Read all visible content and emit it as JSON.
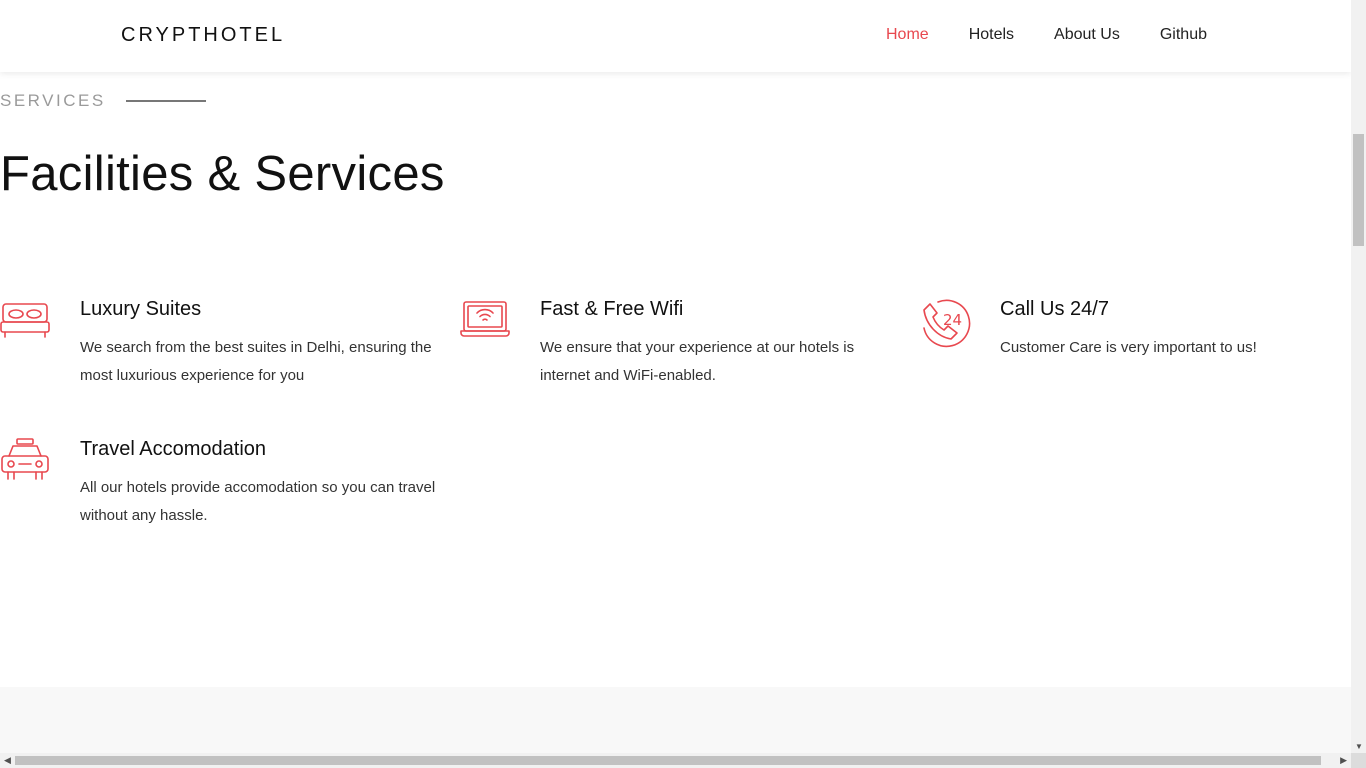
{
  "header": {
    "brand": "CRYPTHOTEL",
    "nav": [
      {
        "label": "Home",
        "active": true
      },
      {
        "label": "Hotels",
        "active": false
      },
      {
        "label": "About Us",
        "active": false
      },
      {
        "label": "Github",
        "active": false
      }
    ]
  },
  "section": {
    "kicker": "SERVICES",
    "title": "Facilities & Services"
  },
  "services": [
    {
      "icon": "bed-icon",
      "title": "Luxury Suites",
      "description": "We search from the best suites in Delhi, ensuring the most luxurious experience for you"
    },
    {
      "icon": "laptop-wifi-icon",
      "title": "Fast & Free Wifi",
      "description": "We ensure that your experience at our hotels is internet and WiFi-enabled."
    },
    {
      "icon": "phone-24-icon",
      "title": "Call Us 24/7",
      "description": "Customer Care is very important to us!"
    },
    {
      "icon": "taxi-icon",
      "title": "Travel Accomodation",
      "description": "All our hotels provide accomodation so you can travel without any hassle."
    }
  ],
  "colors": {
    "accent": "#e8484f",
    "text": "#111111",
    "muted": "#9a9a9a"
  }
}
